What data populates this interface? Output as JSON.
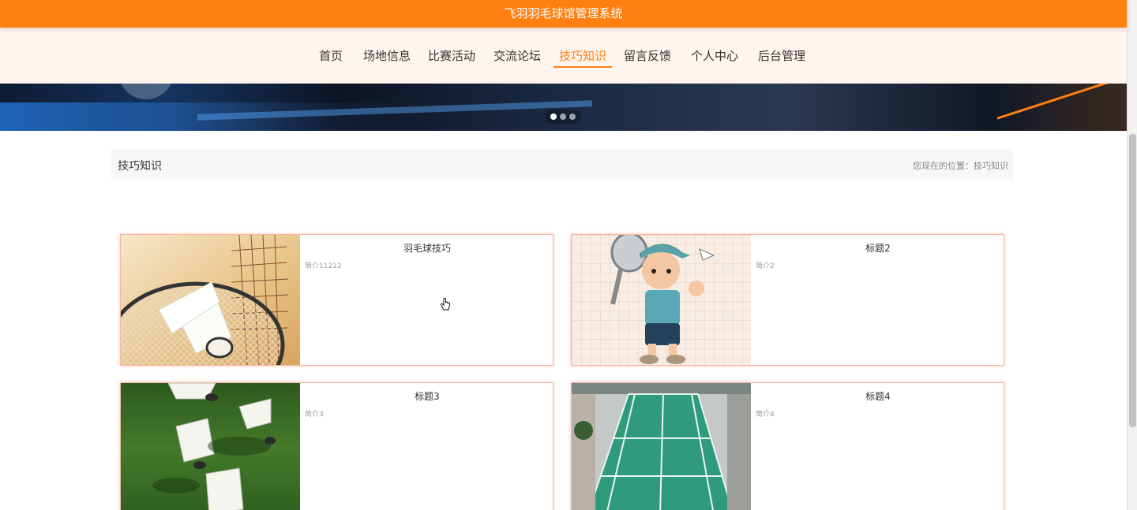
{
  "header": {
    "site_title": "飞羽羽毛球馆管理系统"
  },
  "nav": {
    "items": [
      {
        "label": "首页"
      },
      {
        "label": "场地信息"
      },
      {
        "label": "比赛活动"
      },
      {
        "label": "交流论坛"
      },
      {
        "label": "技巧知识"
      },
      {
        "label": "留言反馈"
      },
      {
        "label": "个人中心"
      },
      {
        "label": "后台管理"
      }
    ],
    "active": "技巧知识"
  },
  "banner": {
    "slide_count": 3,
    "active_slide": 1
  },
  "breadcrumb": {
    "title": "技巧知识",
    "location": "您现在的位置：技巧知识"
  },
  "articles": [
    {
      "title": "羽毛球技巧",
      "intro": "简介11212",
      "image": "shuttlecock-on-racket-photo"
    },
    {
      "title": "标题2",
      "intro": "简介2",
      "image": "cartoon-badminton-player-illustration"
    },
    {
      "title": "标题3",
      "intro": "简介3",
      "image": "shuttlecocks-on-grass-photo"
    },
    {
      "title": "标题4",
      "intro": "简介4",
      "image": "indoor-badminton-court-photo"
    }
  ],
  "colors": {
    "accent": "#ff7f11",
    "nav_bg": "#fff4ee",
    "card_border": "#f3b9a3"
  }
}
